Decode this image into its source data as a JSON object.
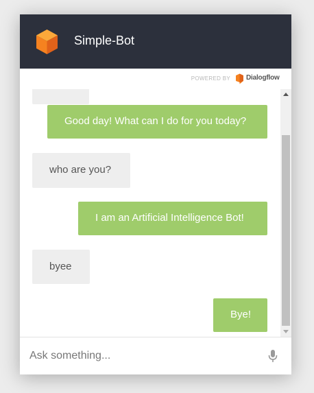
{
  "app": {
    "title": "Simple-Bot"
  },
  "powered_by": {
    "label": "POWERED BY",
    "brand": "Dialogflow"
  },
  "messages": [
    {
      "sender": "bot",
      "text": "Good day! What can I do for you today?"
    },
    {
      "sender": "user",
      "text": "who are you?"
    },
    {
      "sender": "bot",
      "text": "I am an Artificial Intelligence Bot!"
    },
    {
      "sender": "user",
      "text": "byee"
    },
    {
      "sender": "bot",
      "text": "Bye!"
    }
  ],
  "input": {
    "placeholder": "Ask something...",
    "value": ""
  },
  "icons": {
    "logo": "dialogflow-cube-icon",
    "powered_logo": "dialogflow-icon",
    "mic": "microphone-icon"
  },
  "colors": {
    "header": "#2c303c",
    "bot_bubble": "#9fcc6b",
    "user_bubble": "#eeeeee",
    "logo_orange": "#f58220"
  }
}
